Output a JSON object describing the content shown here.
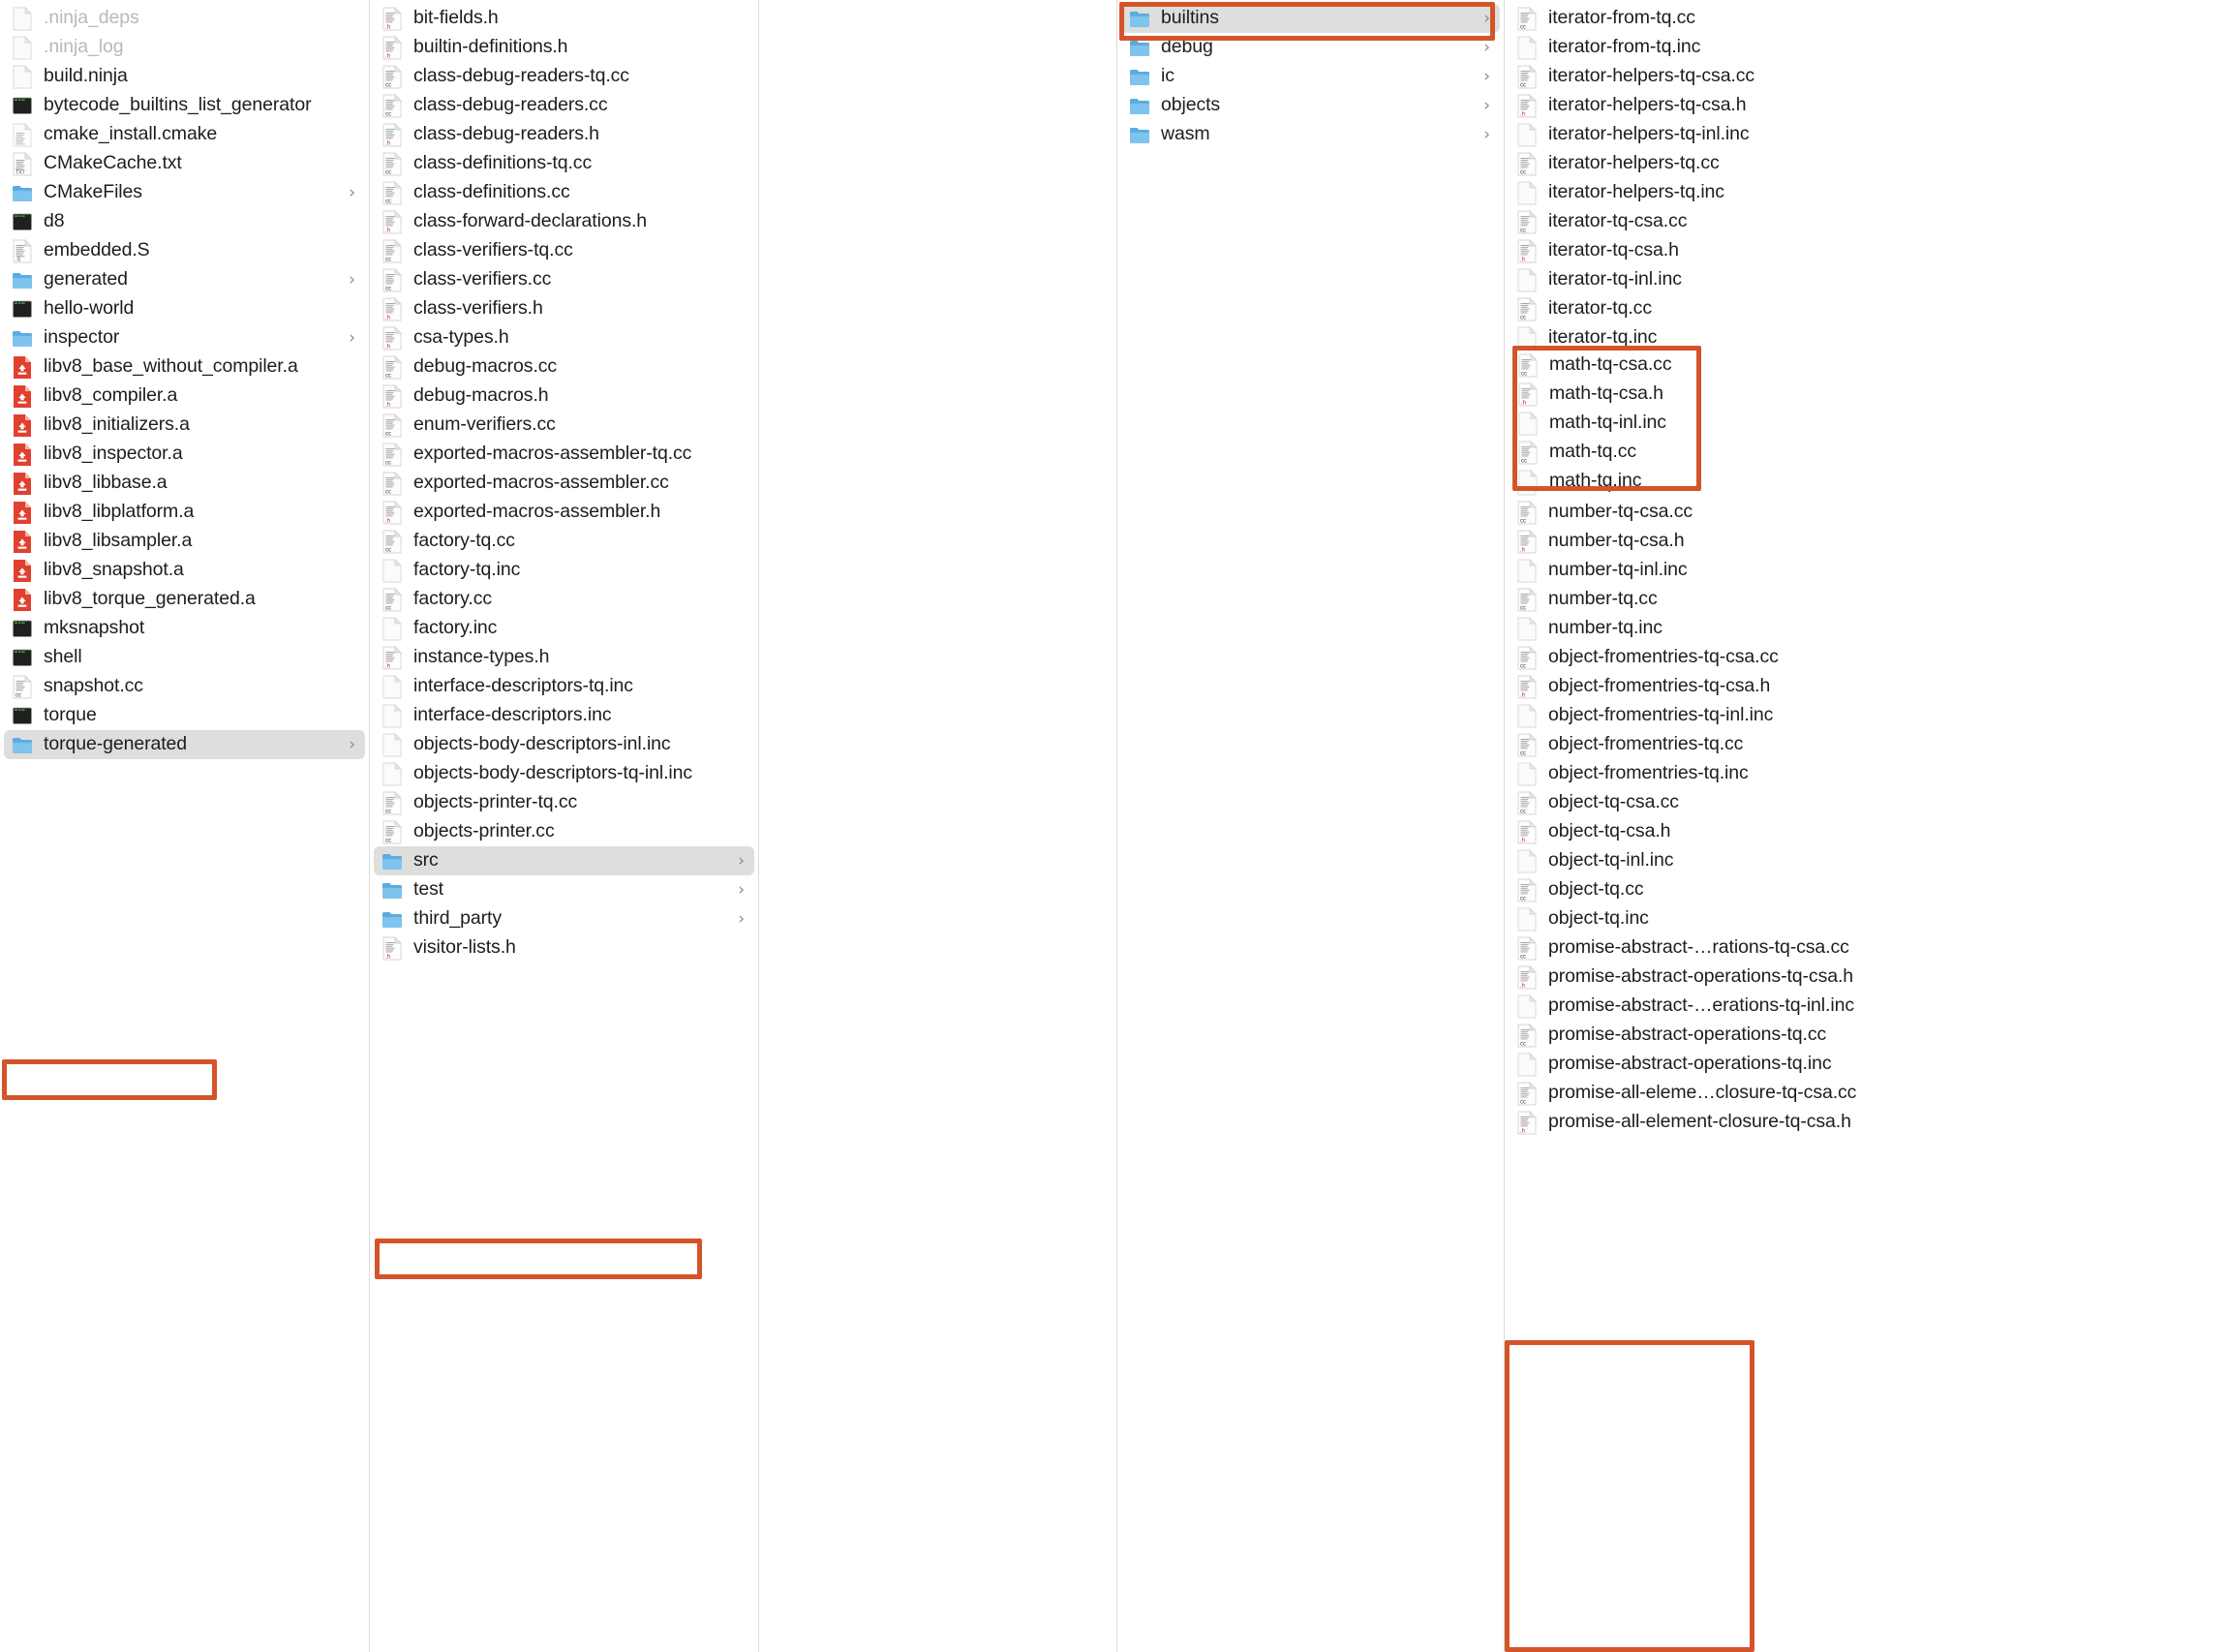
{
  "app": "Finder Column View",
  "accent_highlight_color": "#d4542a",
  "selection_color": "#dededc",
  "columns": [
    {
      "name": "column-out",
      "items": [
        {
          "label": ".ninja_deps",
          "icon": "blank-file-icon",
          "kind": "file",
          "dim": true
        },
        {
          "label": ".ninja_log",
          "icon": "blank-file-icon",
          "kind": "file",
          "dim": true
        },
        {
          "label": "build.ninja",
          "icon": "blank-file-icon",
          "kind": "file"
        },
        {
          "label": "bytecode_builtins_list_generator",
          "icon": "terminal-executable-icon",
          "kind": "exec"
        },
        {
          "label": "cmake_install.cmake",
          "icon": "text-file-icon",
          "kind": "file"
        },
        {
          "label": "CMakeCache.txt",
          "icon": "txt-file-icon",
          "kind": "file"
        },
        {
          "label": "CMakeFiles",
          "icon": "folder-icon",
          "kind": "folder",
          "chevron": "›"
        },
        {
          "label": "d8",
          "icon": "terminal-executable-icon",
          "kind": "exec"
        },
        {
          "label": "embedded.S",
          "icon": "s-file-icon",
          "kind": "file"
        },
        {
          "label": "generated",
          "icon": "folder-icon",
          "kind": "folder",
          "chevron": "›"
        },
        {
          "label": "hello-world",
          "icon": "terminal-executable-icon",
          "kind": "exec"
        },
        {
          "label": "inspector",
          "icon": "folder-icon",
          "kind": "folder",
          "chevron": "›"
        },
        {
          "label": "libv8_base_without_compiler.a",
          "icon": "archive-file-icon",
          "kind": "archive"
        },
        {
          "label": "libv8_compiler.a",
          "icon": "archive-file-icon",
          "kind": "archive"
        },
        {
          "label": "libv8_initializers.a",
          "icon": "archive-file-icon",
          "kind": "archive"
        },
        {
          "label": "libv8_inspector.a",
          "icon": "archive-file-icon",
          "kind": "archive"
        },
        {
          "label": "libv8_libbase.a",
          "icon": "archive-file-icon",
          "kind": "archive"
        },
        {
          "label": "libv8_libplatform.a",
          "icon": "archive-file-icon",
          "kind": "archive"
        },
        {
          "label": "libv8_libsampler.a",
          "icon": "archive-file-icon",
          "kind": "archive"
        },
        {
          "label": "libv8_snapshot.a",
          "icon": "archive-file-icon",
          "kind": "archive"
        },
        {
          "label": "libv8_torque_generated.a",
          "icon": "archive-file-icon",
          "kind": "archive"
        },
        {
          "label": "mksnapshot",
          "icon": "terminal-executable-icon",
          "kind": "exec"
        },
        {
          "label": "shell",
          "icon": "terminal-executable-icon",
          "kind": "exec"
        },
        {
          "label": "snapshot.cc",
          "icon": "cc-file-icon",
          "kind": "file"
        },
        {
          "label": "torque",
          "icon": "terminal-executable-icon",
          "kind": "exec"
        },
        {
          "label": "torque-generated",
          "icon": "folder-icon",
          "kind": "folder",
          "chevron": "›",
          "selected": true,
          "annotated": true
        }
      ]
    },
    {
      "name": "column-torque-generated",
      "items": [
        {
          "label": "bit-fields.h",
          "icon": "h-file-icon",
          "kind": "file"
        },
        {
          "label": "builtin-definitions.h",
          "icon": "h-file-icon",
          "kind": "file"
        },
        {
          "label": "class-debug-readers-tq.cc",
          "icon": "cc-file-icon",
          "kind": "file"
        },
        {
          "label": "class-debug-readers.cc",
          "icon": "cc-file-icon",
          "kind": "file"
        },
        {
          "label": "class-debug-readers.h",
          "icon": "h-file-icon",
          "kind": "file"
        },
        {
          "label": "class-definitions-tq.cc",
          "icon": "cc-file-icon",
          "kind": "file"
        },
        {
          "label": "class-definitions.cc",
          "icon": "cc-file-icon",
          "kind": "file"
        },
        {
          "label": "class-forward-declarations.h",
          "icon": "h-file-icon",
          "kind": "file"
        },
        {
          "label": "class-verifiers-tq.cc",
          "icon": "cc-file-icon",
          "kind": "file"
        },
        {
          "label": "class-verifiers.cc",
          "icon": "cc-file-icon",
          "kind": "file"
        },
        {
          "label": "class-verifiers.h",
          "icon": "h-file-icon",
          "kind": "file"
        },
        {
          "label": "csa-types.h",
          "icon": "h-file-icon",
          "kind": "file"
        },
        {
          "label": "debug-macros.cc",
          "icon": "cc-file-icon",
          "kind": "file"
        },
        {
          "label": "debug-macros.h",
          "icon": "h-file-icon",
          "kind": "file"
        },
        {
          "label": "enum-verifiers.cc",
          "icon": "cc-file-icon",
          "kind": "file"
        },
        {
          "label": "exported-macros-assembler-tq.cc",
          "icon": "cc-file-icon",
          "kind": "file"
        },
        {
          "label": "exported-macros-assembler.cc",
          "icon": "cc-file-icon",
          "kind": "file"
        },
        {
          "label": "exported-macros-assembler.h",
          "icon": "h-file-icon",
          "kind": "file"
        },
        {
          "label": "factory-tq.cc",
          "icon": "cc-file-icon",
          "kind": "file"
        },
        {
          "label": "factory-tq.inc",
          "icon": "blank-file-icon",
          "kind": "file"
        },
        {
          "label": "factory.cc",
          "icon": "cc-file-icon",
          "kind": "file"
        },
        {
          "label": "factory.inc",
          "icon": "blank-file-icon",
          "kind": "file"
        },
        {
          "label": "instance-types.h",
          "icon": "h-file-icon",
          "kind": "file"
        },
        {
          "label": "interface-descriptors-tq.inc",
          "icon": "blank-file-icon",
          "kind": "file"
        },
        {
          "label": "interface-descriptors.inc",
          "icon": "blank-file-icon",
          "kind": "file"
        },
        {
          "label": "objects-body-descriptors-inl.inc",
          "icon": "blank-file-icon",
          "kind": "file"
        },
        {
          "label": "objects-body-descriptors-tq-inl.inc",
          "icon": "blank-file-icon",
          "kind": "file"
        },
        {
          "label": "objects-printer-tq.cc",
          "icon": "cc-file-icon",
          "kind": "file"
        },
        {
          "label": "objects-printer.cc",
          "icon": "cc-file-icon",
          "kind": "file"
        },
        {
          "label": "src",
          "icon": "folder-icon",
          "kind": "folder",
          "chevron": "›",
          "selected": true,
          "annotated": true
        },
        {
          "label": "test",
          "icon": "folder-icon",
          "kind": "folder",
          "chevron": "›"
        },
        {
          "label": "third_party",
          "icon": "folder-icon",
          "kind": "folder",
          "chevron": "›"
        },
        {
          "label": "visitor-lists.h",
          "icon": "h-file-icon",
          "kind": "file"
        }
      ]
    },
    {
      "name": "column-empty-spacer",
      "items": []
    },
    {
      "name": "column-src",
      "items": [
        {
          "label": "builtins",
          "icon": "folder-icon",
          "kind": "folder",
          "chevron": "›",
          "selected": true,
          "annotated": true
        },
        {
          "label": "debug",
          "icon": "folder-icon",
          "kind": "folder",
          "chevron": "›"
        },
        {
          "label": "ic",
          "icon": "folder-icon",
          "kind": "folder",
          "chevron": "›"
        },
        {
          "label": "objects",
          "icon": "folder-icon",
          "kind": "folder",
          "chevron": "›"
        },
        {
          "label": "wasm",
          "icon": "folder-icon",
          "kind": "folder",
          "chevron": "›"
        }
      ]
    },
    {
      "name": "column-builtins",
      "items": [
        {
          "label": "iterator-from-tq.cc",
          "icon": "cc-file-icon",
          "kind": "file"
        },
        {
          "label": "iterator-from-tq.inc",
          "icon": "blank-file-icon",
          "kind": "file"
        },
        {
          "label": "iterator-helpers-tq-csa.cc",
          "icon": "cc-file-icon",
          "kind": "file"
        },
        {
          "label": "iterator-helpers-tq-csa.h",
          "icon": "h-file-icon",
          "kind": "file"
        },
        {
          "label": "iterator-helpers-tq-inl.inc",
          "icon": "blank-file-icon",
          "kind": "file"
        },
        {
          "label": "iterator-helpers-tq.cc",
          "icon": "cc-file-icon",
          "kind": "file"
        },
        {
          "label": "iterator-helpers-tq.inc",
          "icon": "blank-file-icon",
          "kind": "file"
        },
        {
          "label": "iterator-tq-csa.cc",
          "icon": "cc-file-icon",
          "kind": "file"
        },
        {
          "label": "iterator-tq-csa.h",
          "icon": "h-file-icon",
          "kind": "file"
        },
        {
          "label": "iterator-tq-inl.inc",
          "icon": "blank-file-icon",
          "kind": "file"
        },
        {
          "label": "iterator-tq.cc",
          "icon": "cc-file-icon",
          "kind": "file"
        },
        {
          "label": "iterator-tq.inc",
          "icon": "blank-file-icon",
          "kind": "file"
        },
        {
          "label": "math-tq-csa.cc",
          "icon": "cc-file-icon",
          "kind": "file"
        },
        {
          "label": "math-tq-csa.h",
          "icon": "h-file-icon",
          "kind": "file"
        },
        {
          "label": "math-tq-inl.inc",
          "icon": "blank-file-icon",
          "kind": "file"
        },
        {
          "label": "math-tq.cc",
          "icon": "cc-file-icon",
          "kind": "file"
        },
        {
          "label": "math-tq.inc",
          "icon": "blank-file-icon",
          "kind": "file"
        },
        {
          "label": "number-tq-csa.cc",
          "icon": "cc-file-icon",
          "kind": "file"
        },
        {
          "label": "number-tq-csa.h",
          "icon": "h-file-icon",
          "kind": "file"
        },
        {
          "label": "number-tq-inl.inc",
          "icon": "blank-file-icon",
          "kind": "file"
        },
        {
          "label": "number-tq.cc",
          "icon": "cc-file-icon",
          "kind": "file"
        },
        {
          "label": "number-tq.inc",
          "icon": "blank-file-icon",
          "kind": "file"
        },
        {
          "label": "object-fromentries-tq-csa.cc",
          "icon": "cc-file-icon",
          "kind": "file"
        },
        {
          "label": "object-fromentries-tq-csa.h",
          "icon": "h-file-icon",
          "kind": "file"
        },
        {
          "label": "object-fromentries-tq-inl.inc",
          "icon": "blank-file-icon",
          "kind": "file"
        },
        {
          "label": "object-fromentries-tq.cc",
          "icon": "cc-file-icon",
          "kind": "file"
        },
        {
          "label": "object-fromentries-tq.inc",
          "icon": "blank-file-icon",
          "kind": "file"
        },
        {
          "label": "object-tq-csa.cc",
          "icon": "cc-file-icon",
          "kind": "file"
        },
        {
          "label": "object-tq-csa.h",
          "icon": "h-file-icon",
          "kind": "file"
        },
        {
          "label": "object-tq-inl.inc",
          "icon": "blank-file-icon",
          "kind": "file"
        },
        {
          "label": "object-tq.cc",
          "icon": "cc-file-icon",
          "kind": "file"
        },
        {
          "label": "object-tq.inc",
          "icon": "blank-file-icon",
          "kind": "file"
        },
        {
          "label": "promise-abstract-…rations-tq-csa.cc",
          "icon": "cc-file-icon",
          "kind": "file"
        },
        {
          "label": "promise-abstract-operations-tq-csa.h",
          "icon": "h-file-icon",
          "kind": "file"
        },
        {
          "label": "promise-abstract-…erations-tq-inl.inc",
          "icon": "blank-file-icon",
          "kind": "file"
        },
        {
          "label": "promise-abstract-operations-tq.cc",
          "icon": "cc-file-icon",
          "kind": "file"
        },
        {
          "label": "promise-abstract-operations-tq.inc",
          "icon": "blank-file-icon",
          "kind": "file"
        },
        {
          "label": "promise-all-eleme…closure-tq-csa.cc",
          "icon": "cc-file-icon",
          "kind": "file"
        },
        {
          "label": "promise-all-element-closure-tq-csa.h",
          "icon": "h-file-icon",
          "kind": "file"
        }
      ]
    }
  ],
  "annotations": [
    {
      "name": "annotation-torque-generated",
      "target": "torque-generated"
    },
    {
      "name": "annotation-src",
      "target": "src"
    },
    {
      "name": "annotation-builtins",
      "target": "builtins"
    },
    {
      "name": "annotation-math-tq-group",
      "target": "math-tq-csa.cc … math-tq.inc"
    },
    {
      "name": "annotation-promise-group",
      "target": "promise-abstract-… … promise-all-element-closure-tq-csa.h"
    }
  ]
}
